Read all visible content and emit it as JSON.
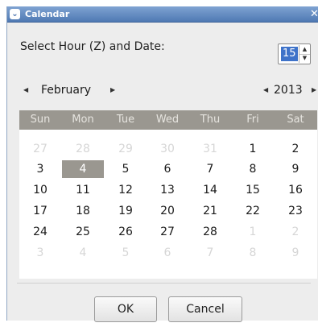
{
  "window": {
    "title": "Calendar",
    "menu_icon": "chevron-down-icon",
    "close_icon": "close-icon"
  },
  "hour": {
    "label": "Select Hour (Z) and Date:",
    "value": "15"
  },
  "nav": {
    "month": "February",
    "year": "2013"
  },
  "calendar": {
    "weekdays": [
      "Sun",
      "Mon",
      "Tue",
      "Wed",
      "Thu",
      "Fri",
      "Sat"
    ],
    "weeks": [
      [
        {
          "d": "27",
          "c": false
        },
        {
          "d": "28",
          "c": false
        },
        {
          "d": "29",
          "c": false
        },
        {
          "d": "30",
          "c": false
        },
        {
          "d": "31",
          "c": false
        },
        {
          "d": "1",
          "c": true
        },
        {
          "d": "2",
          "c": true
        }
      ],
      [
        {
          "d": "3",
          "c": true
        },
        {
          "d": "4",
          "c": true,
          "s": true
        },
        {
          "d": "5",
          "c": true
        },
        {
          "d": "6",
          "c": true
        },
        {
          "d": "7",
          "c": true
        },
        {
          "d": "8",
          "c": true
        },
        {
          "d": "9",
          "c": true
        }
      ],
      [
        {
          "d": "10",
          "c": true
        },
        {
          "d": "11",
          "c": true
        },
        {
          "d": "12",
          "c": true
        },
        {
          "d": "13",
          "c": true
        },
        {
          "d": "14",
          "c": true
        },
        {
          "d": "15",
          "c": true
        },
        {
          "d": "16",
          "c": true
        }
      ],
      [
        {
          "d": "17",
          "c": true
        },
        {
          "d": "18",
          "c": true
        },
        {
          "d": "19",
          "c": true
        },
        {
          "d": "20",
          "c": true
        },
        {
          "d": "21",
          "c": true
        },
        {
          "d": "22",
          "c": true
        },
        {
          "d": "23",
          "c": true
        }
      ],
      [
        {
          "d": "24",
          "c": true
        },
        {
          "d": "25",
          "c": true
        },
        {
          "d": "26",
          "c": true
        },
        {
          "d": "27",
          "c": true
        },
        {
          "d": "28",
          "c": true
        },
        {
          "d": "1",
          "c": false
        },
        {
          "d": "2",
          "c": false
        }
      ],
      [
        {
          "d": "3",
          "c": false
        },
        {
          "d": "4",
          "c": false
        },
        {
          "d": "5",
          "c": false
        },
        {
          "d": "6",
          "c": false
        },
        {
          "d": "7",
          "c": false
        },
        {
          "d": "8",
          "c": false
        },
        {
          "d": "9",
          "c": false
        }
      ]
    ]
  },
  "buttons": {
    "ok": "OK",
    "cancel": "Cancel"
  },
  "colors": {
    "titlebar": "#4f79b3",
    "selection": "#3f73c9",
    "header": "#9a9790"
  }
}
